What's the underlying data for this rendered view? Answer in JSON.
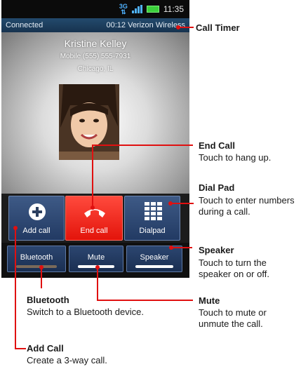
{
  "status_bar": {
    "network": "3G",
    "time": "11:35"
  },
  "call_bar": {
    "state": "Connected",
    "timer_carrier": "00:12 Verizon Wireless"
  },
  "caller": {
    "name": "Kristine Kelley",
    "number": "Mobile (555) 555-7931",
    "location": "Chicago, IL"
  },
  "buttons": {
    "add_call": "Add call",
    "end_call": "End call",
    "dialpad": "Dialpad"
  },
  "toggles": {
    "bluetooth": {
      "label": "Bluetooth",
      "on": false
    },
    "mute": {
      "label": "Mute",
      "on": true
    },
    "speaker": {
      "label": "Speaker",
      "on": true
    }
  },
  "callouts": {
    "call_timer": {
      "title": "Call Timer"
    },
    "end_call": {
      "title": "End Call",
      "desc": "Touch to hang up."
    },
    "dial_pad": {
      "title": "Dial Pad",
      "desc": "Touch to enter numbers during a call."
    },
    "speaker": {
      "title": "Speaker",
      "desc": "Touch to turn the speaker on or off."
    },
    "bluetooth": {
      "title": "Bluetooth",
      "desc": "Switch to a Bluetooth device."
    },
    "mute": {
      "title": "Mute",
      "desc": "Touch to mute or unmute the call."
    },
    "add_call": {
      "title": "Add Call",
      "desc": "Create a 3-way call."
    }
  },
  "colors": {
    "callout": "#e01010",
    "end_call": "#f0281e",
    "button_blue": "#2c4670"
  }
}
